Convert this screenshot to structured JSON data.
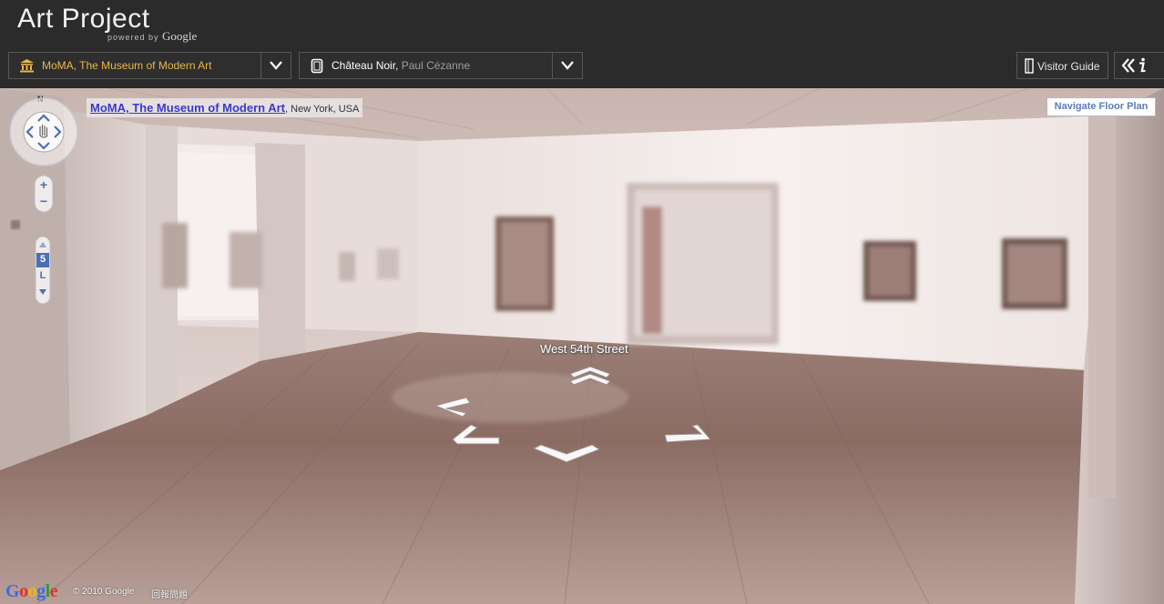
{
  "header": {
    "title": "Art Project",
    "powered_prefix": "powered by",
    "powered_brand": "Google"
  },
  "museum_select": {
    "selected": "MoMA, The Museum of Modern Art",
    "icon": "museum-icon"
  },
  "artwork_select": {
    "title": "Château Noir,",
    "artist": " Paul Cézanne",
    "icon": "artwork-frame-icon"
  },
  "visitor_guide": {
    "label": "Visitor Guide",
    "icon": "guide-icon"
  },
  "info_button": {
    "icon": "collapse-info-icon"
  },
  "streetview": {
    "place_name": "MoMA, The Museum of Modern Art",
    "place_location": ", New York, USA",
    "navigate_floor_plan": "Navigate Floor Plan",
    "street_label": "West 54th Street",
    "compass_label": "N",
    "floor_current": "5",
    "floor_other": "L",
    "copyright": "© 2010 Google",
    "report": "回報問題"
  },
  "colors": {
    "header_bg": "#2b2b2b",
    "museum_text": "#e8b84a",
    "link": "#3a3ac8",
    "floor_plan_text": "#5c7bb8"
  }
}
